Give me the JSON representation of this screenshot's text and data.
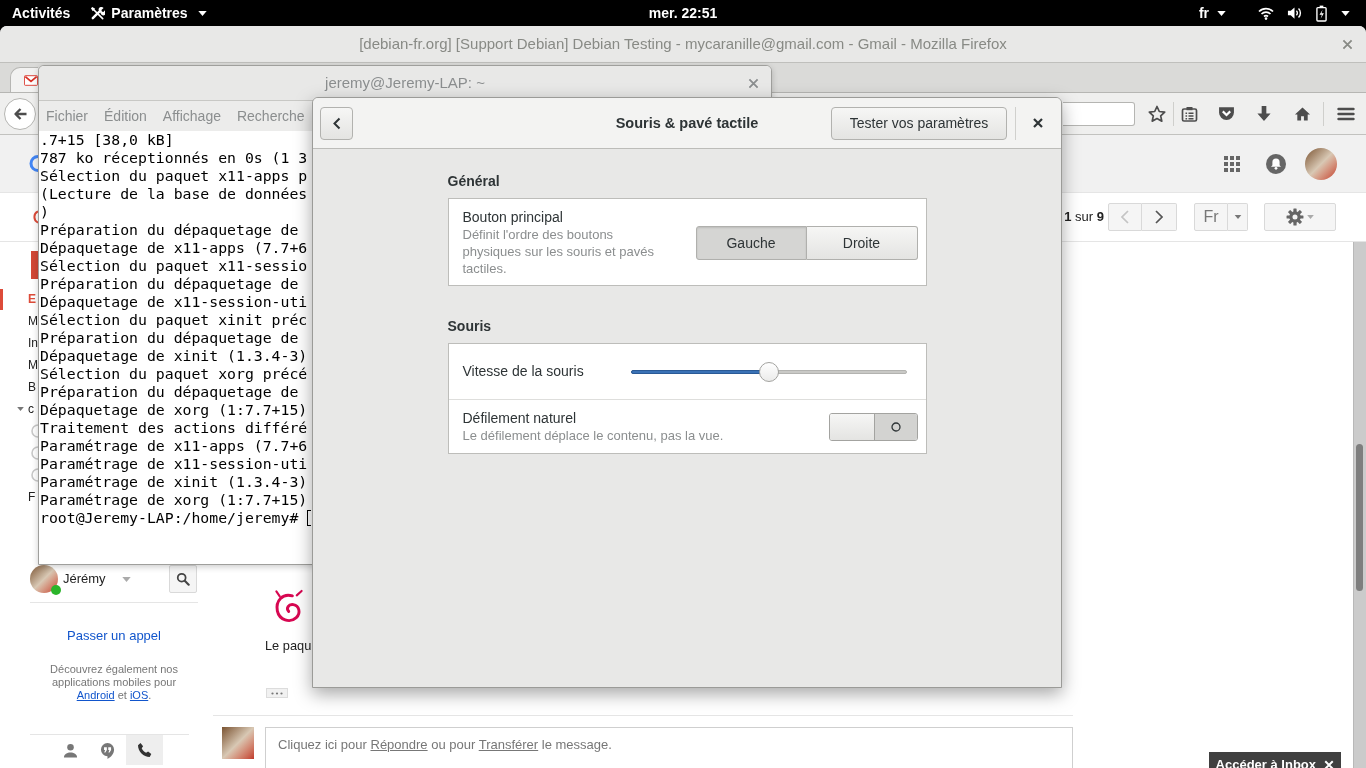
{
  "top_bar": {
    "activities": "Activités",
    "app_menu": "Paramètres",
    "clock": "mer. 22:51",
    "keyboard_layout": "fr"
  },
  "firefox": {
    "title": "[debian-fr.org] [Support Debian] Debian Testing - mycaranille@gmail.com - Gmail - Mozilla Firefox"
  },
  "gmail": {
    "pager": "**1** sur **9**",
    "nav_buttons": [
      {
        "kind": "previous",
        "disabled": true
      },
      {
        "kind": "next",
        "disabled": false
      }
    ],
    "language": "Fr",
    "labels": [
      {
        "kind": "label",
        "text": "E",
        "selected": true
      },
      {
        "kind": "label",
        "text": "M",
        "selected": false
      },
      {
        "kind": "label",
        "text": "In",
        "selected": false
      },
      {
        "kind": "label",
        "text": "M",
        "selected": false
      },
      {
        "kind": "label",
        "text": "B",
        "selected": false
      },
      {
        "kind": "group",
        "text": "c",
        "selected": false
      },
      {
        "kind": "category",
        "selected": false
      },
      {
        "kind": "category",
        "selected": false
      },
      {
        "kind": "category",
        "selected": false
      },
      {
        "kind": "label",
        "text": "F",
        "selected": false
      }
    ],
    "chat": {
      "user": "Jérémy",
      "online": true,
      "call_link": "Passer un appel",
      "apps_note": [
        {
          "kind": "text",
          "text": "Découvrez également nos applications mobiles pour "
        },
        {
          "kind": "link",
          "text": "Android"
        },
        {
          "kind": "text",
          "text": " et "
        },
        {
          "kind": "link",
          "text": "iOS"
        },
        {
          "kind": "text",
          "text": "."
        }
      ],
      "tabs": [
        {
          "kind": "contacts",
          "selected": false
        },
        {
          "kind": "hangouts",
          "selected": false
        },
        {
          "kind": "phone",
          "selected": true
        }
      ]
    },
    "message": {
      "excerpt": "Le paqu"
    },
    "reply": [
      {
        "kind": "text",
        "text": "Cliquez ici pour "
      },
      {
        "kind": "link",
        "text": "Répondre"
      },
      {
        "kind": "text",
        "text": " ou pour "
      },
      {
        "kind": "link",
        "text": "Transférer"
      },
      {
        "kind": "text",
        "text": " le message."
      }
    ],
    "inbox_button": "Accéder à Inbox"
  },
  "terminal": {
    "title": "jeremy@Jeremy-LAP: ~",
    "menu": [
      "Fichier",
      "Édition",
      "Affichage",
      "Recherche"
    ],
    "lines": [
      ".7+15 [38,0 kB]",
      "787 ko réceptionnés en 0s (1 3",
      "Sélection du paquet x11-apps p",
      "(Lecture de la base de données",
      ")",
      "Préparation du dépaquetage de",
      "Dépaquetage de x11-apps (7.7+6",
      "Sélection du paquet x11-sessio",
      "Préparation du dépaquetage de",
      "Dépaquetage de x11-session-uti",
      "Sélection du paquet xinit préc",
      "Préparation du dépaquetage de",
      "Dépaquetage de xinit (1.3.4-3)",
      "Sélection du paquet xorg précé",
      "Préparation du dépaquetage de",
      "Dépaquetage de xorg (1:7.7+15)",
      "Traitement des actions différé",
      "Paramétrage de x11-apps (7.7+6",
      "Paramétrage de x11-session-uti",
      "Paramétrage de xinit (1.3.4-3)",
      "Paramétrage de xorg (1:7.7+15)"
    ],
    "prompt": "root@Jeremy-LAP:/home/jeremy#"
  },
  "dialog": {
    "title": "Souris & pavé tactile",
    "test_button": "Tester vos paramètres",
    "sections": [
      {
        "heading": "Général",
        "rows": [
          {
            "kind": "segmented",
            "label": "Bouton principal",
            "description": "Définit l'ordre des boutons physiques sur les souris et pavés tactiles.",
            "options": [
              {
                "label": "Gauche",
                "selected": true
              },
              {
                "label": "Droite",
                "selected": false
              }
            ]
          }
        ]
      },
      {
        "heading": "Souris",
        "rows": [
          {
            "kind": "slider",
            "label": "Vitesse de la souris",
            "level": 0.5
          },
          {
            "kind": "switch",
            "label": "Défilement naturel",
            "description": "Le défilement déplace le contenu, pas la vue.",
            "on": false
          }
        ]
      }
    ]
  }
}
